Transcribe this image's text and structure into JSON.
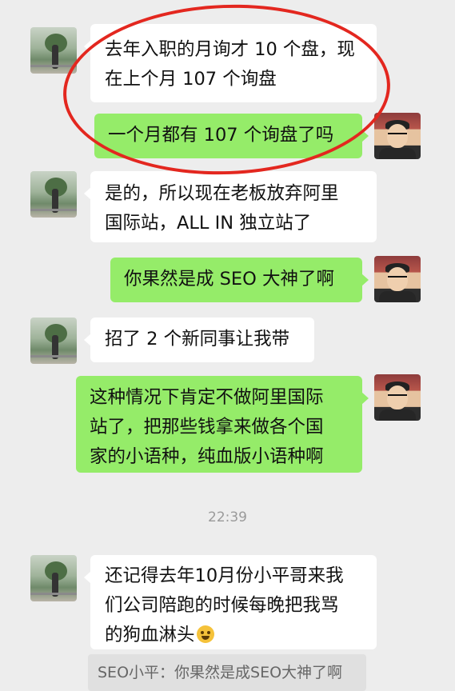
{
  "messages": [
    {
      "side": "left",
      "lines": [
        "去年入职的月询才 10 个盘，现",
        "在上个月 107 个询盘"
      ]
    },
    {
      "side": "right",
      "lines": [
        "一个月都有 107 个询盘了吗"
      ]
    },
    {
      "side": "left",
      "lines": [
        "是的，所以现在老板放弃阿里",
        "国际站，ALL IN 独立站了"
      ]
    },
    {
      "side": "right",
      "lines": [
        "你果然是成 SEO 大神了啊"
      ]
    },
    {
      "side": "left",
      "lines": [
        "招了 2 个新同事让我带"
      ]
    },
    {
      "side": "right",
      "lines": [
        "这种情况下肯定不做阿里国际",
        "站了，把那些钱拿来做各个国",
        "家的小语种，纯血版小语种啊"
      ]
    },
    {
      "side": "left",
      "lines": [
        "还记得去年10月份小平哥来我",
        "们公司陪跑的时候每晚把我骂",
        "的狗血淋头"
      ],
      "emoji": "crying-laughing-emoji"
    }
  ],
  "timestamp": "22:39",
  "quote": "SEO小平：你果然是成SEO大神了啊",
  "colors": {
    "background": "#ededed",
    "green_bubble": "#95ec69",
    "white_bubble": "#ffffff",
    "annotation_circle": "#e3271f"
  }
}
